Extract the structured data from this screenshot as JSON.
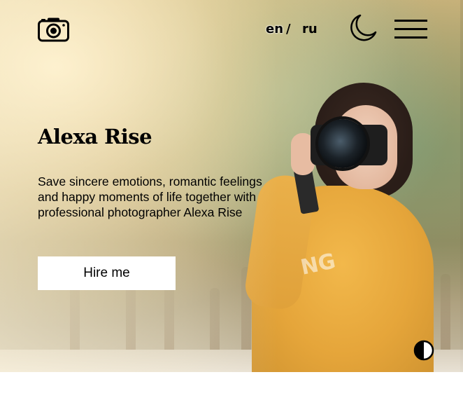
{
  "header": {
    "logo_icon": "camera-icon",
    "languages": [
      "en",
      "ru"
    ],
    "language_separator": "/",
    "active_language": "en",
    "theme_icon": "moon-icon",
    "menu_icon": "hamburger-menu-icon"
  },
  "hero": {
    "title": "Alexa Rise",
    "description_lines": [
      "Save sincere emotions, romantic feelings",
      "and happy moments of life together with",
      "professional photographer Alexa Rise"
    ],
    "cta_label": "Hire me",
    "background_description_icon": "photographer-image",
    "sweater_print": "NG"
  },
  "floating": {
    "contrast_icon": "contrast-half-circle-icon"
  },
  "colors": {
    "accent": "#e5a53a",
    "text": "#000000",
    "button_bg": "#ffffff"
  }
}
